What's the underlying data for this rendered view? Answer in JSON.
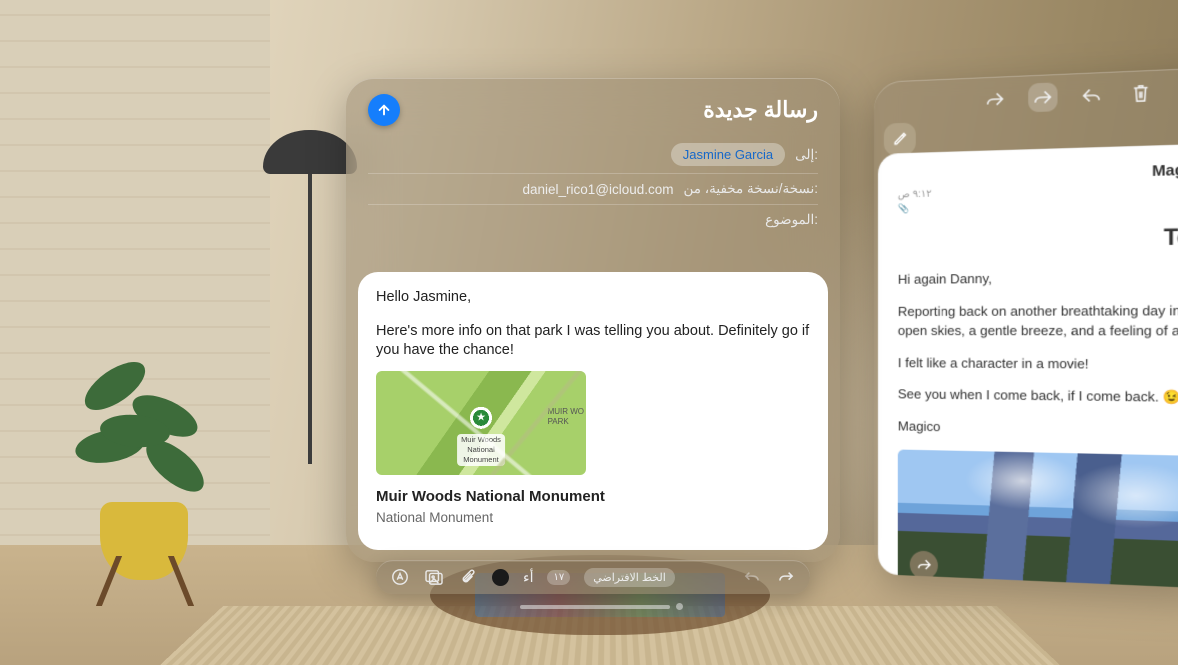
{
  "compose": {
    "title": "رسالة جديدة",
    "to_label": "إلى:",
    "to_chip": "Jasmine Garcia",
    "cc_label": "نسخة/نسخة مخفية، من:",
    "from_email": "daniel_rico1@icloud.com",
    "subject_label": "الموضوع:",
    "greeting": "Hello Jasmine,",
    "paragraph": "Here's more info on that park I was telling you about. Definitely go if you have the chance!",
    "map_pin_label": "Muir Woods\nNational\nMonument",
    "map_side_label": "MUIR WO\nPARK",
    "link_title": "Muir Woods National Monument",
    "link_subtitle": "National Monument"
  },
  "toolbar": {
    "text_size_glyph": "أء",
    "font_size_indicator": "١٧",
    "font_pill": "الخط الافتراضي"
  },
  "reader": {
    "from_name_clipped": "Magico",
    "timestamp": "٩:١٢ ص",
    "subject_clipped": "Toda",
    "p1": "Hi again Danny,",
    "p2": "Reporting back on another breathtaking day in th open skies, a gentle breeze, and a feeling of adve",
    "p3": "I felt like a character in a movie!",
    "p4": "See you when I come back, if I come back. ",
    "emoji": "😉",
    "signature": "Magico"
  }
}
